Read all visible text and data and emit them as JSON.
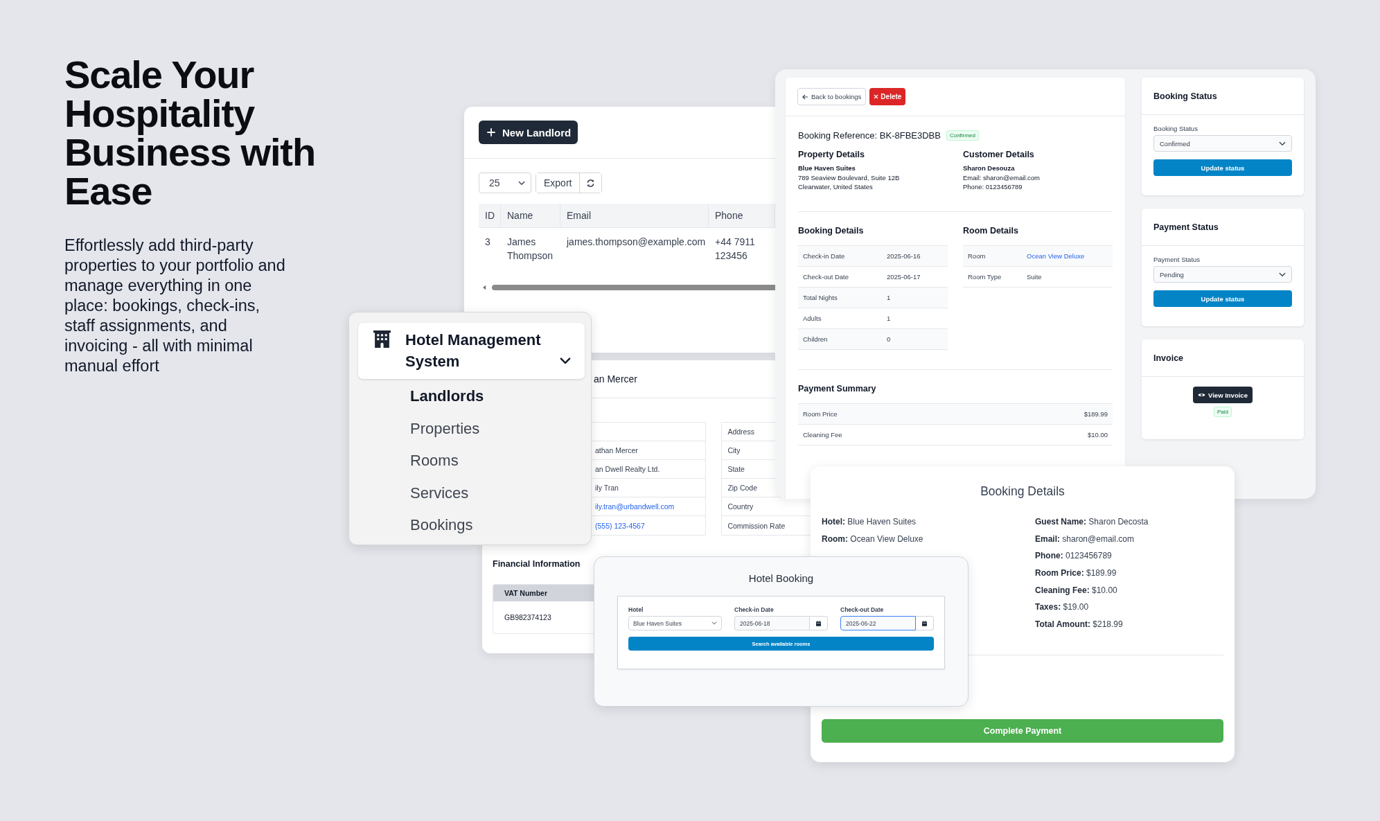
{
  "headline": "Scale Your Hospitality Business with Ease",
  "tagline": "Effortlessly add third-party properties to your portfolio and manage everything in one place: bookings, check-ins, staff assignments, and invoicing - all with minimal manual effort",
  "landlords": {
    "new_button": "New Landlord",
    "page_size": "25",
    "export_button": "Export",
    "columns": [
      "ID",
      "Name",
      "Email",
      "Phone"
    ],
    "rows": [
      [
        "3",
        "James Thompson",
        "james.thompson@example.com",
        "+44 7911 123456"
      ]
    ]
  },
  "landlord_detail": {
    "title": "an Mercer",
    "values": [
      {
        "text": "athan Mercer",
        "kind": "text"
      },
      {
        "text": "an Dwell Realty Ltd.",
        "kind": "text"
      },
      {
        "text": "ily Tran",
        "kind": "text"
      },
      {
        "text": "ily.tran@urbandwell.com",
        "kind": "link"
      },
      {
        "text": "(555) 123-4567",
        "kind": "link"
      }
    ],
    "labels": [
      "Address",
      "City",
      "State",
      "Zip Code",
      "Country",
      "Commission Rate"
    ],
    "financial_title": "Financial Information",
    "vat_label": "VAT Number",
    "vat_value": "GB982374123"
  },
  "booking": {
    "back_button": "Back to bookings",
    "delete_button": "Delete",
    "reference": "Booking Reference: BK-8FBE3DBB",
    "status_badge": "Confirmed",
    "property": {
      "title": "Property Details",
      "name": "Blue Haven Suites",
      "lines": [
        "789 Seaview Boulevard, Suite 12B",
        "Clearwater, United States"
      ]
    },
    "customer": {
      "title": "Customer Details",
      "name": "Sharon Desouza",
      "lines": [
        "Email: sharon@email.com",
        "Phone: 0123456789"
      ]
    },
    "booking_details": {
      "title": "Booking Details",
      "rows": [
        {
          "label": "Check-in Date",
          "value": "2025-06-16"
        },
        {
          "label": "Check-out Date",
          "value": "2025-06-17"
        },
        {
          "label": "Total Nights",
          "value": "1"
        },
        {
          "label": "Adults",
          "value": "1"
        },
        {
          "label": "Children",
          "value": "0"
        }
      ]
    },
    "room_details": {
      "title": "Room Details",
      "rows": [
        {
          "label": "Room",
          "value": "Ocean View Deluxe",
          "kind": "link"
        },
        {
          "label": "Room Type",
          "value": "Suite",
          "kind": "text"
        }
      ]
    },
    "payment_summary": {
      "title": "Payment Summary",
      "rows": [
        {
          "label": "Room Price",
          "value": "$189.99"
        },
        {
          "label": "Cleaning Fee",
          "value": "$10.00"
        }
      ]
    }
  },
  "status_cards": [
    {
      "title": "Booking Status",
      "label": "Booking Status",
      "value": "Confirmed",
      "button": "Update status"
    },
    {
      "title": "Payment Status",
      "label": "Payment Status",
      "value": "Pending",
      "button": "Update status"
    }
  ],
  "invoice": {
    "title": "Invoice",
    "button": "View Invoice",
    "badge": "Paid"
  },
  "booking_card": {
    "title": "Booking Details",
    "left": [
      "**Hotel:** Blue Haven Suites",
      "**Room:** Ocean View Deluxe"
    ],
    "right": [
      "**Guest Name:** Sharon Decosta",
      "**Email:** sharon@email.com",
      "**Phone:** 0123456789",
      "**Room Price:** $189.99",
      "**Cleaning Fee:** $10.00",
      "**Taxes:** $19.00",
      "**Total Amount:** $218.99"
    ],
    "button": "Complete Payment"
  },
  "hotel_booking": {
    "title": "Hotel Booking",
    "hotel_label": "Hotel",
    "hotel_value": "Blue Haven Suites",
    "dates": [
      {
        "label": "Check-in Date",
        "value": "2025-06-18",
        "focused": false
      },
      {
        "label": "Check-out Date",
        "value": "2025-06-22",
        "focused": true
      }
    ],
    "button": "Search available rooms"
  },
  "menu": {
    "title": "Hotel Management System",
    "expanded": true,
    "items": [
      {
        "label": "Landlords",
        "selected": true
      },
      {
        "label": "Properties",
        "selected": false
      },
      {
        "label": "Rooms",
        "selected": false
      },
      {
        "label": "Services",
        "selected": false
      },
      {
        "label": "Bookings",
        "selected": false
      }
    ]
  }
}
